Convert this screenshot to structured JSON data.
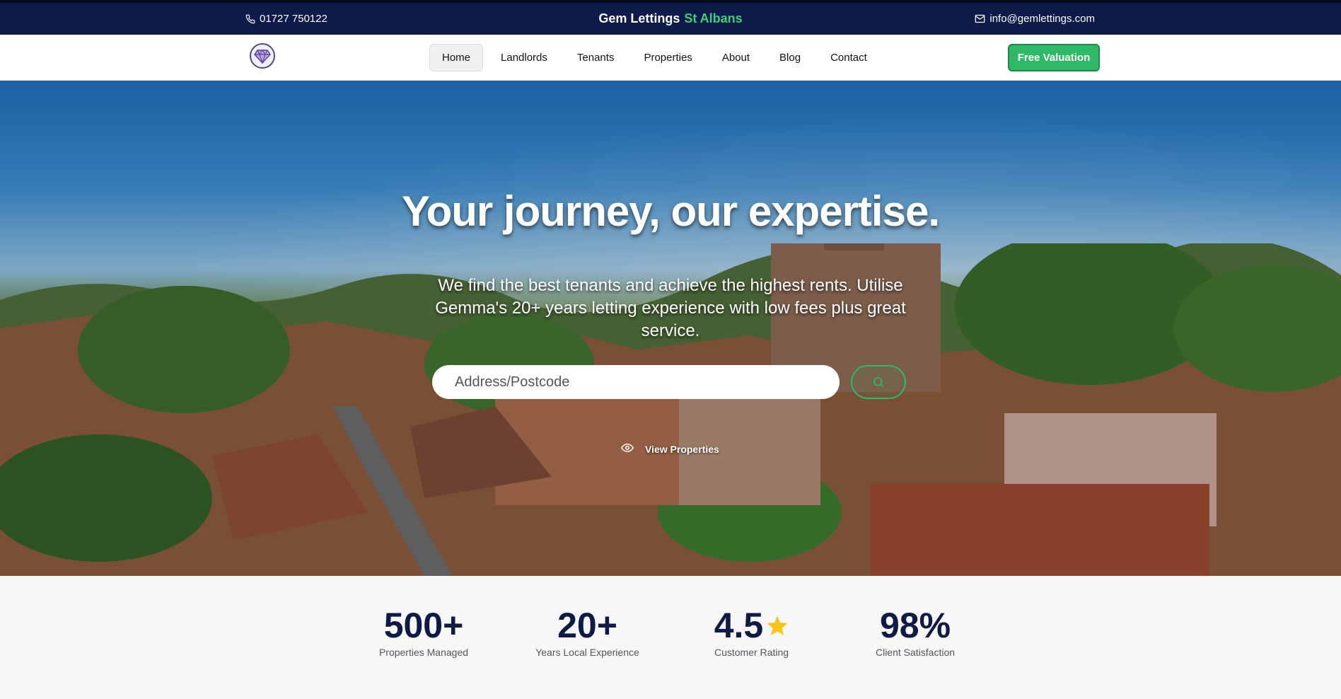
{
  "topbar": {
    "phone": "01727 750122",
    "brand_name": "Gem Lettings",
    "brand_location": "St Albans",
    "email": "info@gemlettings.com"
  },
  "nav": {
    "items": [
      {
        "label": "Home",
        "active": true
      },
      {
        "label": "Landlords",
        "active": false
      },
      {
        "label": "Tenants",
        "active": false
      },
      {
        "label": "Properties",
        "active": false
      },
      {
        "label": "About",
        "active": false
      },
      {
        "label": "Blog",
        "active": false
      },
      {
        "label": "Contact",
        "active": false
      }
    ],
    "cta_label": "Free Valuation"
  },
  "hero": {
    "heading": "Your journey, our expertise.",
    "subheading": "We find the best tenants and achieve the highest rents. Utilise Gemma's 20+ years letting experience with low fees plus great service.",
    "search_placeholder": "Address/Postcode",
    "view_link": "View Properties"
  },
  "stats": [
    {
      "value": "500+",
      "label": "Properties Managed"
    },
    {
      "value": "20+",
      "label": "Years Local Experience"
    },
    {
      "value": "4.5",
      "label": "Customer Rating",
      "icon": "star-icon"
    },
    {
      "value": "98%",
      "label": "Client Satisfaction"
    }
  ],
  "colors": {
    "navy": "#0e1a4a",
    "accent_green": "#2fb866",
    "star_yellow": "#f5c518"
  }
}
